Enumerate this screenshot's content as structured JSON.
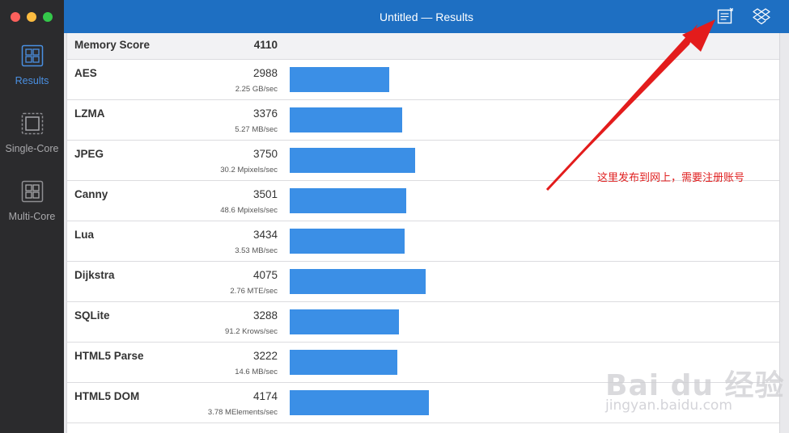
{
  "window": {
    "title": "Untitled — Results",
    "traffic_lights": [
      "close",
      "minimize",
      "zoom"
    ]
  },
  "sidebar": {
    "items": [
      {
        "label": "Results",
        "icon": "results-grid-icon",
        "active": true
      },
      {
        "label": "Single-Core",
        "icon": "single-core-chip-icon",
        "active": false
      },
      {
        "label": "Multi-Core",
        "icon": "multi-core-chip-icon",
        "active": false
      }
    ]
  },
  "toolbar": {
    "icons": [
      "share-document-icon",
      "dropbox-icon"
    ]
  },
  "results": {
    "header": {
      "name": "Memory Score",
      "score": "4110"
    },
    "max_score": 4174,
    "rows": [
      {
        "name": "AES",
        "score": "2988",
        "unit": "2.25 GB/sec",
        "value": 2988
      },
      {
        "name": "LZMA",
        "score": "3376",
        "unit": "5.27 MB/sec",
        "value": 3376
      },
      {
        "name": "JPEG",
        "score": "3750",
        "unit": "30.2 Mpixels/sec",
        "value": 3750
      },
      {
        "name": "Canny",
        "score": "3501",
        "unit": "48.6 Mpixels/sec",
        "value": 3501
      },
      {
        "name": "Lua",
        "score": "3434",
        "unit": "3.53 MB/sec",
        "value": 3434
      },
      {
        "name": "Dijkstra",
        "score": "4075",
        "unit": "2.76 MTE/sec",
        "value": 4075
      },
      {
        "name": "SQLite",
        "score": "3288",
        "unit": "91.2 Krows/sec",
        "value": 3288
      },
      {
        "name": "HTML5 Parse",
        "score": "3222",
        "unit": "14.6 MB/sec",
        "value": 3222
      },
      {
        "name": "HTML5 DOM",
        "score": "4174",
        "unit": "3.78 MElements/sec",
        "value": 4174
      }
    ]
  },
  "annotation": {
    "text": "这里发布到网上，需要注册账号",
    "color": "#e02020"
  },
  "watermark": {
    "logo": "Bai du 经验",
    "url": "jingyan.baidu.com"
  },
  "colors": {
    "titlebar": "#1e6fc2",
    "bar": "#3b8fe6",
    "accent": "#4a90e2"
  }
}
